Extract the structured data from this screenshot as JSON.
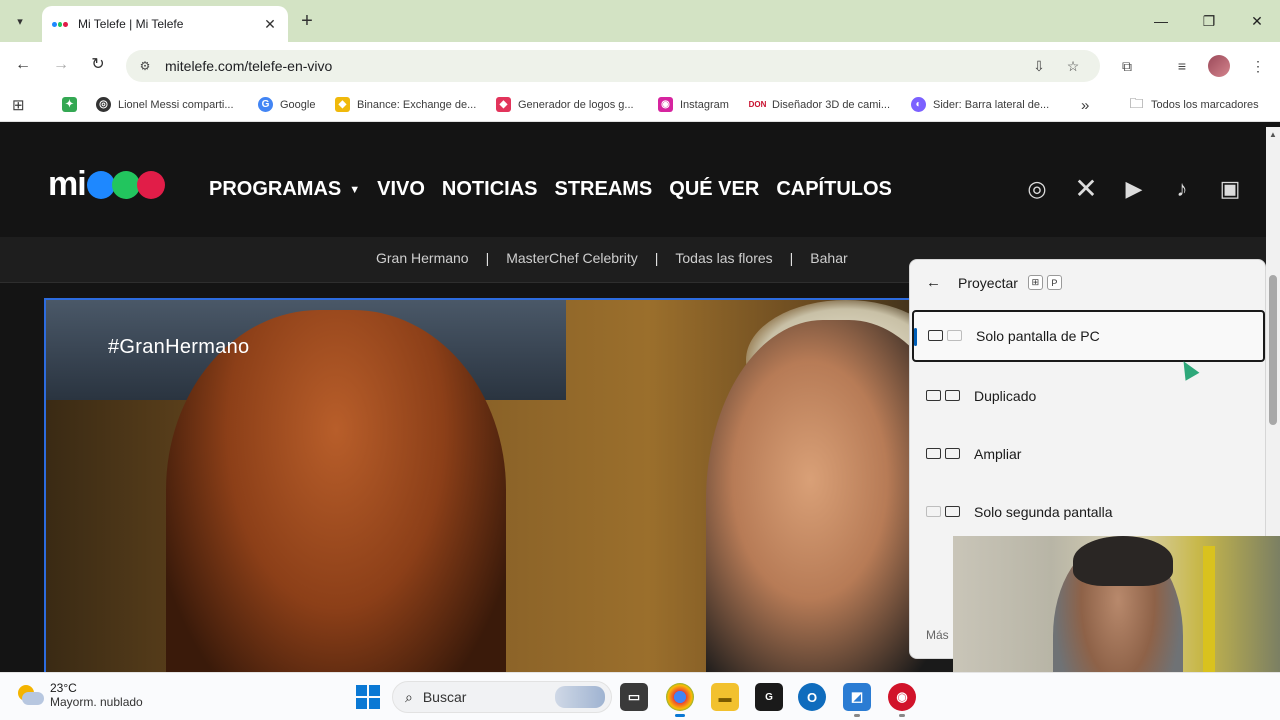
{
  "browser": {
    "tab_title": "Mi Telefe | Mi Telefe",
    "url": "mitelefe.com/telefe-en-vivo",
    "bookmarks": [
      {
        "label": "",
        "color": "#34a853"
      },
      {
        "label": "Lionel Messi comparti...",
        "color": "#333333"
      },
      {
        "label": "Google",
        "color": "#4285f4"
      },
      {
        "label": "Binance: Exchange de...",
        "color": "#f0b90b"
      },
      {
        "label": "Generador de logos g...",
        "color": "#e2345b"
      },
      {
        "label": "Instagram",
        "color": "#d6249f"
      },
      {
        "label": "Diseñador 3D de cami...",
        "color": "#c8102e"
      },
      {
        "label": "Sider: Barra lateral de...",
        "color": "#7b61ff"
      }
    ],
    "bookmarks_overflow": "»",
    "all_bookmarks": "Todos los marcadores"
  },
  "site": {
    "logo": "mi",
    "logo_colors": [
      "#1e88ff",
      "#22c55e",
      "#e11d48"
    ],
    "menu": [
      "PROGRAMAS",
      "VIVO",
      "NOTICIAS",
      "STREAMS",
      "QUÉ VER",
      "CAPÍTULOS"
    ],
    "social_icons": [
      "instagram-icon",
      "x-icon",
      "youtube-icon",
      "tiktok-icon",
      "twitch-icon"
    ],
    "subnav": [
      "Gran Hermano",
      "MasterChef Celebrity",
      "Todas las flores",
      "Bahar"
    ],
    "subnav_separator": "|",
    "player_hashtag": "#GranHermano"
  },
  "flyout": {
    "title": "Proyectar",
    "shortcut_keys": [
      "⊞",
      "P"
    ],
    "options": [
      {
        "label": "Solo pantalla de PC",
        "selected": true
      },
      {
        "label": "Duplicado",
        "selected": false
      },
      {
        "label": "Ampliar",
        "selected": false
      },
      {
        "label": "Solo segunda pantalla",
        "selected": false
      }
    ],
    "more": "Más"
  },
  "taskbar": {
    "temperature": "23°C",
    "condition": "Mayorm. nublado",
    "search_placeholder": "Buscar"
  }
}
